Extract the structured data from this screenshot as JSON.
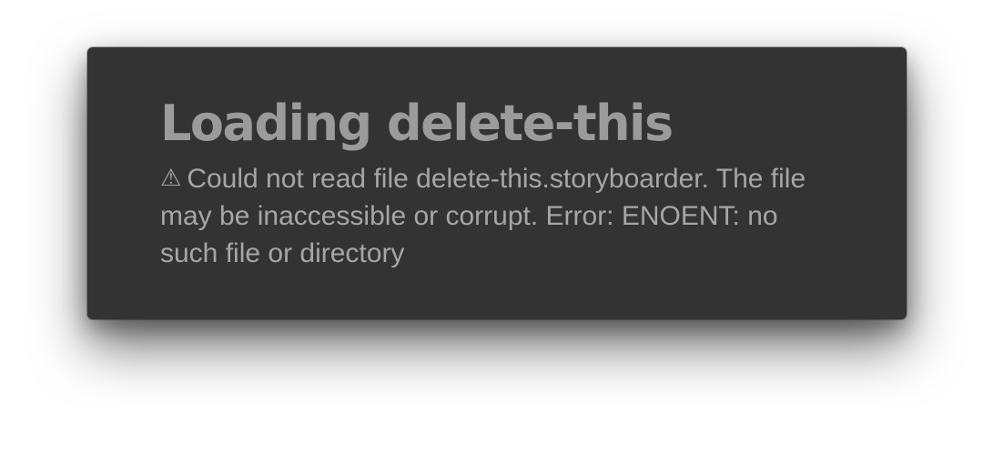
{
  "dialog": {
    "title": "Loading delete-this",
    "warning_icon": "warning-triangle-icon",
    "message": "Could not read file delete-this.storyboarder. The file may be inaccessible or corrupt. Error: ENOENT: no such file or directory"
  },
  "colors": {
    "page_background": "#ffffff",
    "dialog_background": "#333333",
    "title_text": "#9b9b9b",
    "message_text": "#a6a6a6"
  }
}
